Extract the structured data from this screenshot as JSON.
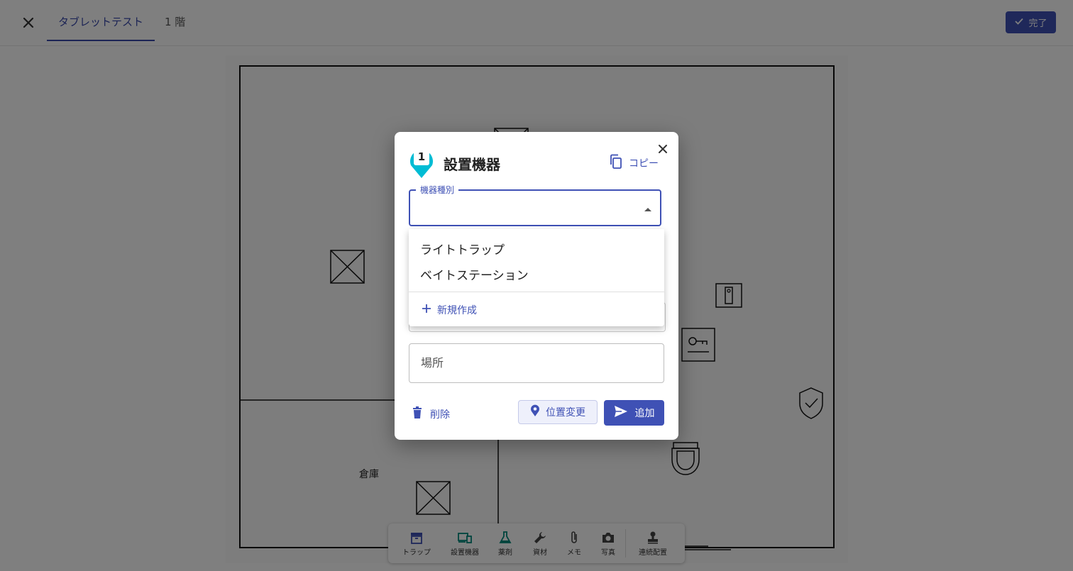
{
  "header": {
    "tabs": [
      {
        "label": "タブレットテスト",
        "active": true
      },
      {
        "label": "1 階",
        "active": false
      }
    ],
    "done_label": "完了",
    "accent": "#3f51b5"
  },
  "floorplan": {
    "rooms": [
      {
        "label": "倉庫"
      }
    ],
    "icons": [
      "cross-box-icon",
      "cabinet-icon",
      "key-box-icon",
      "shield-check-icon",
      "toilet-icon"
    ]
  },
  "toolbar": {
    "items": [
      {
        "label": "トラップ",
        "icon": "archive-icon"
      },
      {
        "label": "設置機器",
        "icon": "devices-icon"
      },
      {
        "label": "薬剤",
        "icon": "flask-icon"
      },
      {
        "label": "資材",
        "icon": "wrench-icon"
      },
      {
        "label": "メモ",
        "icon": "paperclip-icon"
      },
      {
        "label": "写真",
        "icon": "camera-icon"
      },
      {
        "label": "連続配置",
        "icon": "stamp-icon"
      }
    ]
  },
  "dialog": {
    "pin_number": "1",
    "title": "設置機器",
    "copy_label": "コピー",
    "device_type_label": "機器種別",
    "device_type_value": "",
    "location_placeholder": "場所",
    "delete_label": "削除",
    "move_label": "位置変更",
    "add_label": "追加",
    "pin_color": "#00bcd4"
  },
  "dropdown": {
    "options": [
      "ライトトラップ",
      "ベイトステーション"
    ],
    "new_label": "新規作成"
  }
}
